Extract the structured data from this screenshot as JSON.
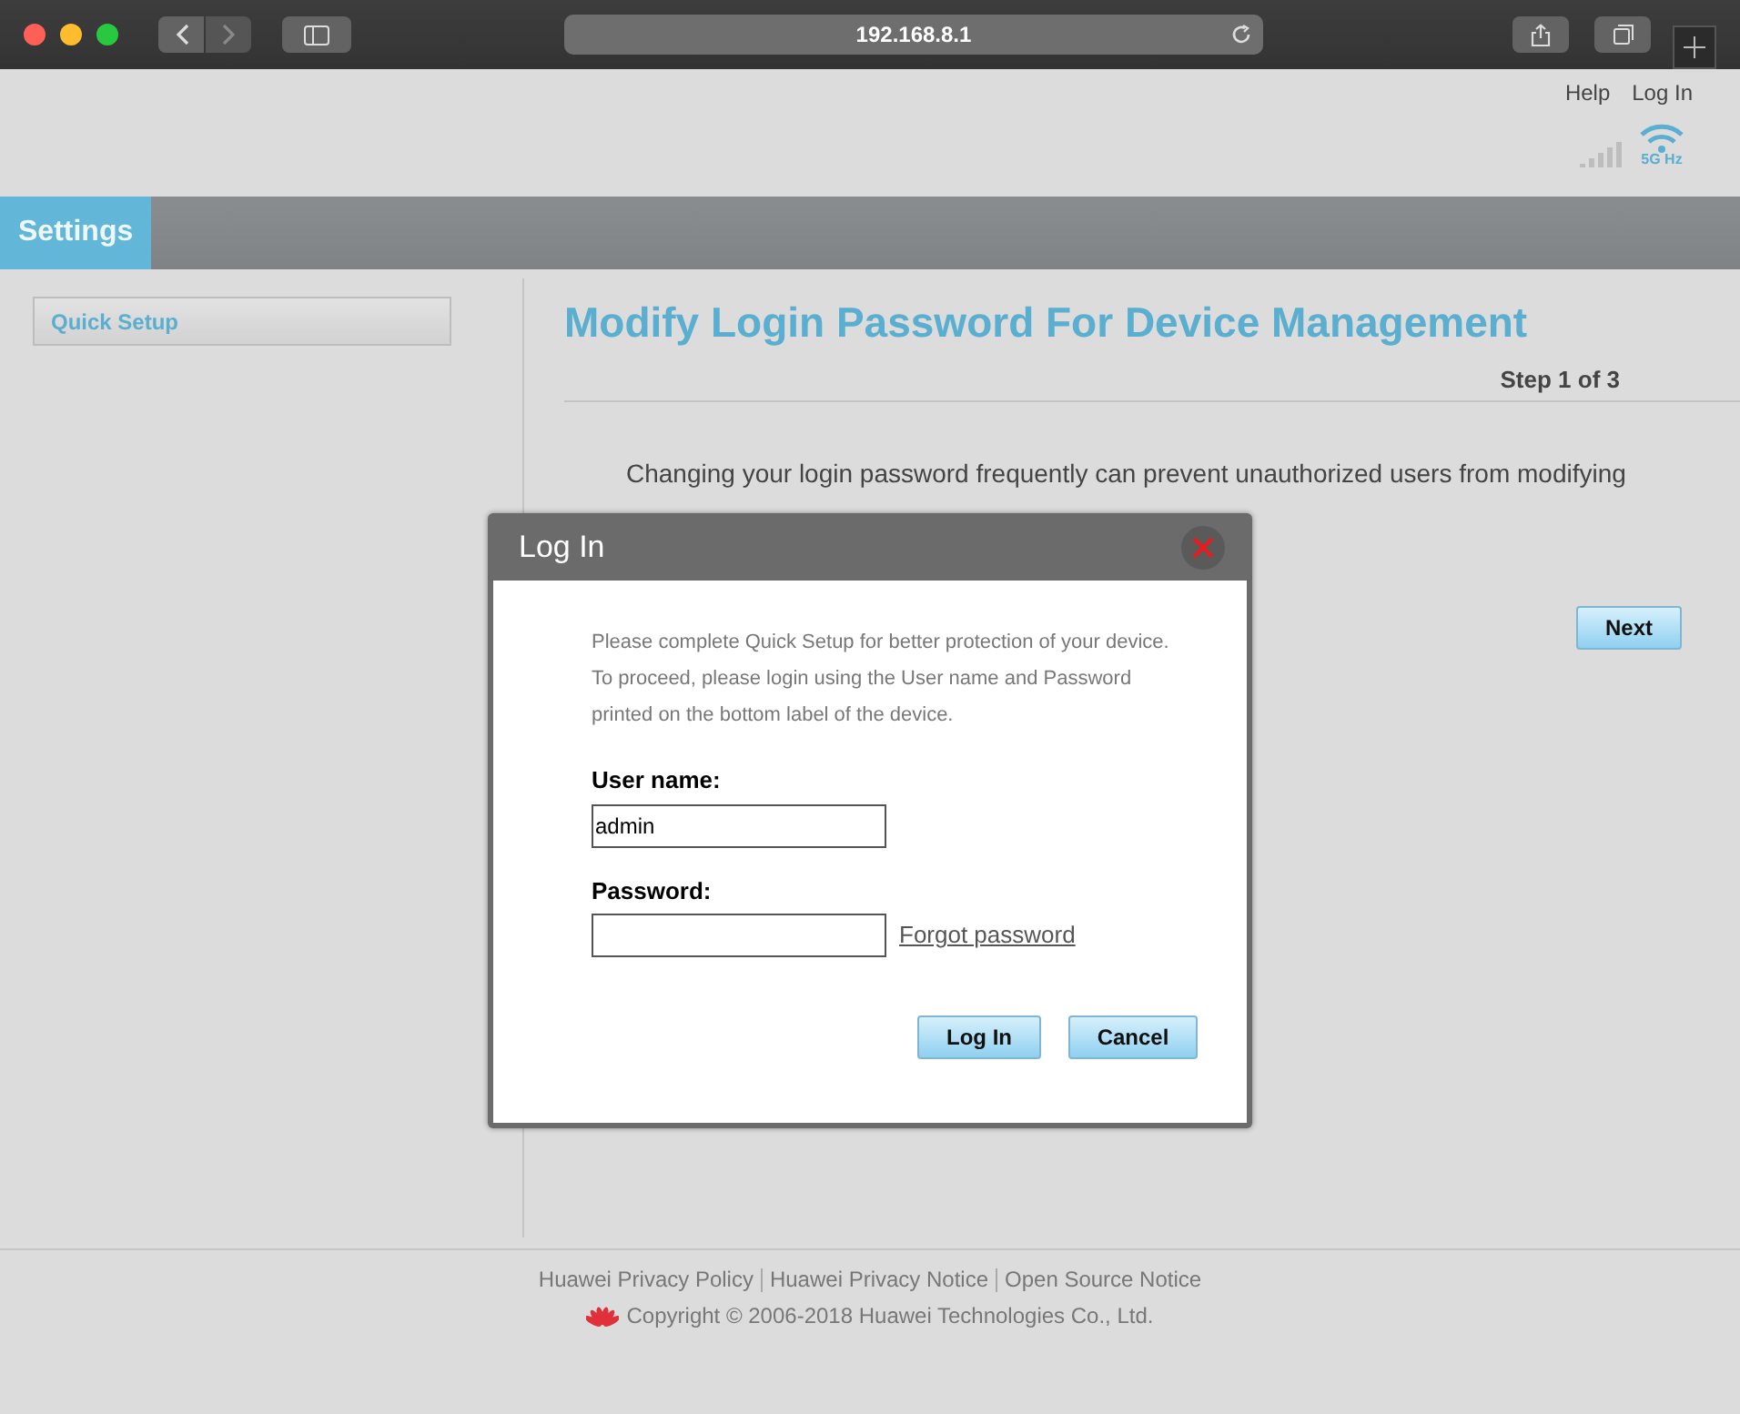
{
  "browser": {
    "url": "192.168.8.1"
  },
  "header": {
    "links": [
      "Help",
      "Log In"
    ],
    "wifi_band": "5G Hz"
  },
  "nav": {
    "tabs": [
      {
        "label": "Settings",
        "selected": true
      }
    ]
  },
  "sidebar": {
    "items": [
      {
        "label": "Quick Setup",
        "selected": true
      }
    ]
  },
  "content": {
    "title": "Modify Login Password For Device Management",
    "step": "Step 1 of 3",
    "description": "Changing your login password frequently can prevent unauthorized users from modifying",
    "next_button": "Next"
  },
  "dialog": {
    "title": "Log In",
    "message": "Please complete Quick Setup for better protection of your device. To proceed, please login using the User name and Password printed on the bottom label of the device.",
    "fields": [
      {
        "label": "User name:",
        "value": "admin"
      },
      {
        "label": "Password:",
        "link": "Forgot password"
      }
    ],
    "buttons": [
      "Log In",
      "Cancel"
    ]
  },
  "footer": {
    "links": [
      "Huawei Privacy Policy",
      "Huawei Privacy Notice",
      "Open Source Notice"
    ],
    "copyright": "Copyright © 2006-2018 Huawei Technologies Co., Ltd."
  }
}
